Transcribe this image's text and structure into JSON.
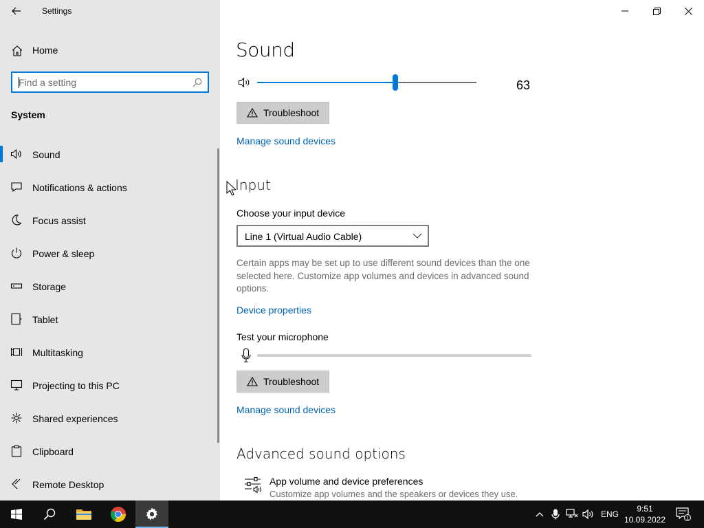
{
  "window": {
    "title": "Settings",
    "controls": {
      "minimize": "minimize",
      "maximize": "restore",
      "close": "close"
    }
  },
  "sidebar": {
    "home_label": "Home",
    "search_placeholder": "Find a setting",
    "section_label": "System",
    "items": [
      {
        "label": "Sound",
        "icon": "speaker-icon",
        "active": true
      },
      {
        "label": "Notifications & actions",
        "icon": "notification-icon"
      },
      {
        "label": "Focus assist",
        "icon": "moon-icon"
      },
      {
        "label": "Power & sleep",
        "icon": "power-icon"
      },
      {
        "label": "Storage",
        "icon": "storage-icon"
      },
      {
        "label": "Tablet",
        "icon": "tablet-icon"
      },
      {
        "label": "Multitasking",
        "icon": "multitasking-icon"
      },
      {
        "label": "Projecting to this PC",
        "icon": "projecting-icon"
      },
      {
        "label": "Shared experiences",
        "icon": "shared-experiences-icon"
      },
      {
        "label": "Clipboard",
        "icon": "clipboard-icon"
      },
      {
        "label": "Remote Desktop",
        "icon": "remote-desktop-icon"
      }
    ]
  },
  "main": {
    "page_title": "Sound",
    "output": {
      "volume_value": "63",
      "volume_level": 0.63,
      "troubleshoot_label": "Troubleshoot",
      "manage_devices_link": "Manage sound devices"
    },
    "input": {
      "heading": "Input",
      "choose_label": "Choose your input device",
      "selected_device": "Line 1 (Virtual Audio Cable)",
      "description": "Certain apps may be set up to use different sound devices than the one selected here. Customize app volumes and devices in advanced sound options.",
      "device_properties_link": "Device properties",
      "test_mic_label": "Test your microphone",
      "mic_level": 0,
      "troubleshoot_label": "Troubleshoot",
      "manage_devices_link": "Manage sound devices"
    },
    "advanced": {
      "heading": "Advanced sound options",
      "app_volume_title": "App volume and device preferences",
      "app_volume_desc": "Customize app volumes and the speakers or devices they use."
    }
  },
  "taskbar": {
    "apps": [
      "start",
      "search",
      "file-explorer",
      "chrome",
      "settings"
    ],
    "active_app": "settings",
    "language": "ENG",
    "time": "9:51",
    "date": "10.09.2022",
    "notification_count": "1"
  },
  "colors": {
    "accent": "#0078d7",
    "link": "#0063b1",
    "sidebar_bg": "#e6e6e6",
    "taskbar_bg": "#101010"
  }
}
